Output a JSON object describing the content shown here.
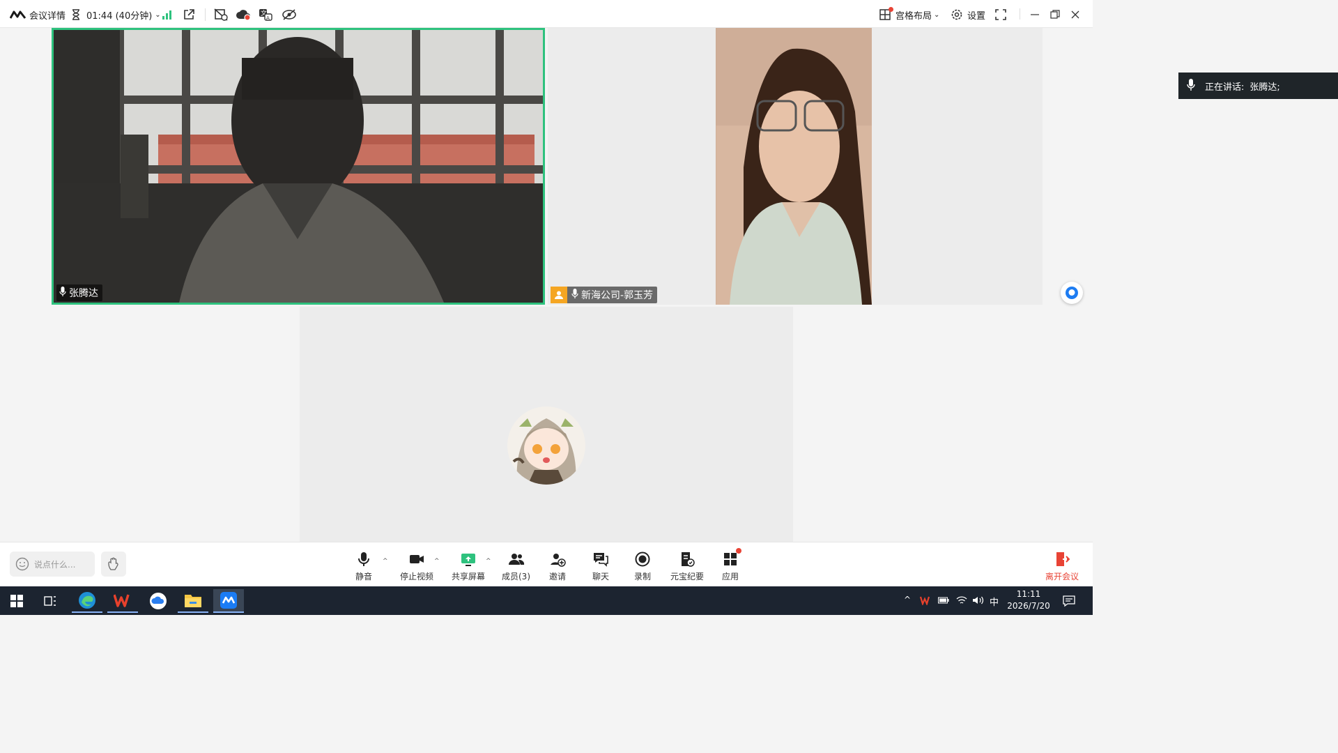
{
  "topbar": {
    "meeting_details": "会议详情",
    "timer": "01:44 (40分钟)",
    "layout": "宫格布局",
    "settings": "设置"
  },
  "participants": [
    {
      "name": "张腾达",
      "active_speaker": true
    },
    {
      "name": "新海公司-郭玉芳"
    },
    {
      "name": "",
      "avatar": "anime-avatar"
    }
  ],
  "speaking": {
    "label": "正在讲话:",
    "name": "张腾达;"
  },
  "chat_input": {
    "placeholder": "说点什么..."
  },
  "toolbar": {
    "mute": "静音",
    "stop_video": "停止视频",
    "share_screen": "共享屏幕",
    "members": "成员(3)",
    "invite": "邀请",
    "chat": "聊天",
    "record": "录制",
    "yuanbao": "元宝纪要",
    "apps": "应用",
    "leave": "离开会议"
  },
  "taskbar": {
    "time": "11:11",
    "date": "2026/7/20",
    "ime": "中"
  },
  "colors": {
    "accent_green": "#2ec27e",
    "leave_red": "#e84335",
    "taskbar": "#1c2430",
    "speaker_border": "#2ec27e"
  }
}
